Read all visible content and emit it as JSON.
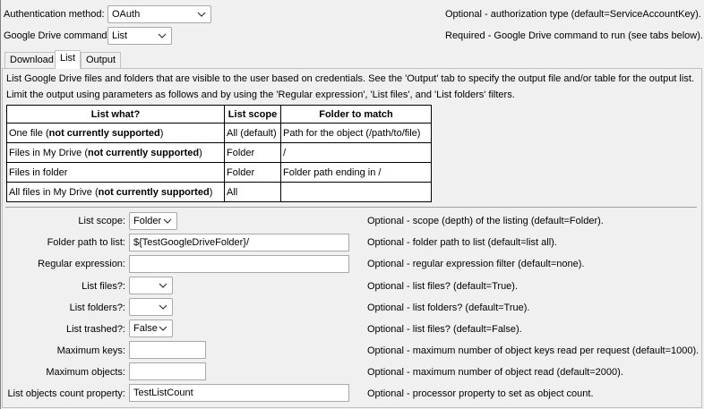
{
  "auth": {
    "label": "Authentication method:",
    "value": "OAuth",
    "desc": "Optional - authorization type (default=ServiceAccountKey)."
  },
  "command": {
    "label": "Google Drive command:",
    "value": "List",
    "desc": "Required - Google Drive command to run (see tabs below)."
  },
  "tabs": [
    "Download",
    "List",
    "Output"
  ],
  "intro": [
    "List Google Drive files and folders that are visible to the user based on credentials.  See the 'Output' tab to specify the output file and/or table for the output list.",
    "Limit the output using parameters as follows and by using the 'Regular expression', 'List files', and 'List folders' filters."
  ],
  "table": {
    "headers": [
      "List what?",
      "List scope",
      "Folder to match"
    ],
    "rows": [
      {
        "what": "One file (",
        "what_bold": "not currently supported",
        "what_end": ")",
        "scope": "All (default)",
        "match": "Path for the object (/path/to/file)"
      },
      {
        "what": "Files in My Drive (",
        "what_bold": "not currently supported",
        "what_end": ")",
        "scope": "Folder",
        "match": "/"
      },
      {
        "what": "Files in folder",
        "what_bold": "",
        "what_end": "",
        "scope": "Folder",
        "match": "Folder path ending in /"
      },
      {
        "what": "All files in My Drive (",
        "what_bold": "not currently supported",
        "what_end": ")",
        "scope": "All",
        "match": ""
      }
    ]
  },
  "params": {
    "list_scope": {
      "label": "List scope:",
      "value": "Folder",
      "desc": "Optional - scope (depth) of the listing (default=Folder)."
    },
    "folder_path": {
      "label": "Folder path to list:",
      "value": "${TestGoogleDriveFolder}/",
      "desc": "Optional - folder path to list (default=list all)."
    },
    "regex": {
      "label": "Regular expression:",
      "value": "",
      "desc": "Optional - regular expression filter (default=none)."
    },
    "list_files": {
      "label": "List files?:",
      "value": "",
      "desc": "Optional - list files? (default=True)."
    },
    "list_folders": {
      "label": "List folders?:",
      "value": "",
      "desc": "Optional - list folders? (default=True)."
    },
    "list_trashed": {
      "label": "List trashed?:",
      "value": "False",
      "desc": "Optional - list files? (default=False)."
    },
    "max_keys": {
      "label": "Maximum keys:",
      "value": "",
      "desc": "Optional - maximum number of object keys read per request (default=1000)."
    },
    "max_objects": {
      "label": "Maximum objects:",
      "value": "",
      "desc": "Optional - maximum number of object read (default=2000)."
    },
    "count_prop": {
      "label": "List objects count property:",
      "value": "TestListCount",
      "desc": "Optional - processor property to set as object count."
    }
  }
}
